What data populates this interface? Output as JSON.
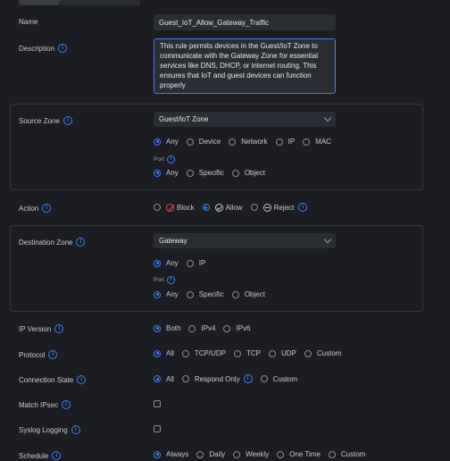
{
  "form": {
    "name": {
      "label": "Name",
      "value": "Guest_IoT_Allow_Gateway_Traffic"
    },
    "description": {
      "label": "Description",
      "value": "This rule permits devices in the Guest/IoT Zone to communicate with the Gateway Zone for essential services like DNS, DHCP, or internet routing. This ensures that IoT and guest devices can function properly"
    },
    "source_zone": {
      "label": "Source Zone",
      "value": "Guest/IoT Zone",
      "targets": [
        "Any",
        "Device",
        "Network",
        "IP",
        "MAC"
      ],
      "target_selected": "Any",
      "port_label": "Port",
      "port_options": [
        "Any",
        "Specific",
        "Object"
      ],
      "port_selected": "Any"
    },
    "action": {
      "label": "Action",
      "options": [
        "Block",
        "Allow",
        "Reject"
      ],
      "selected": "Allow"
    },
    "destination_zone": {
      "label": "Destination Zone",
      "value": "Gateway",
      "targets": [
        "Any",
        "IP"
      ],
      "target_selected": "Any",
      "port_label": "Port",
      "port_options": [
        "Any",
        "Specific",
        "Object"
      ],
      "port_selected": "Any"
    },
    "ip_version": {
      "label": "IP Version",
      "options": [
        "Both",
        "IPv4",
        "IPv6"
      ],
      "selected": "Both"
    },
    "protocol": {
      "label": "Protocol",
      "options": [
        "All",
        "TCP/UDP",
        "TCP",
        "UDP",
        "Custom"
      ],
      "selected": "All"
    },
    "connection_state": {
      "label": "Connection State",
      "options": [
        "All",
        "Respond Only",
        "Custom"
      ],
      "selected": "All"
    },
    "match_ipsec": {
      "label": "Match IPsec",
      "checked": false
    },
    "syslog_logging": {
      "label": "Syslog Logging",
      "checked": false
    },
    "schedule": {
      "label": "Schedule",
      "options": [
        "Always",
        "Daily",
        "Weekly",
        "One Time",
        "Custom"
      ],
      "selected": "Always"
    }
  },
  "colors": {
    "accent": "#3b82f6",
    "block": "#e5484d",
    "background": "#1b1d22",
    "field": "#2a2d33"
  },
  "icons": [
    "info-icon",
    "chevron-down-icon",
    "block-icon",
    "allow-icon",
    "reject-icon"
  ]
}
